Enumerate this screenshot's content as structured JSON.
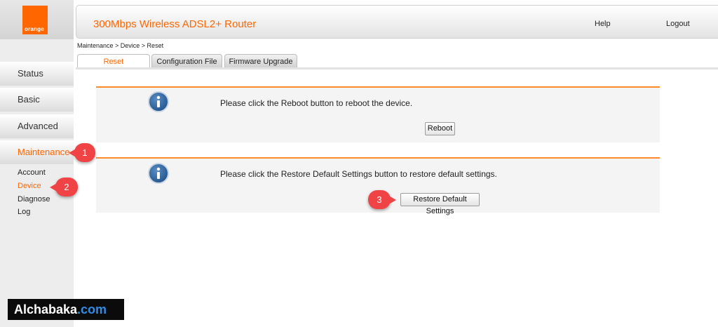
{
  "logo": {
    "text": "orange",
    "color": "#ff6600"
  },
  "header": {
    "title": "300Mbps Wireless ADSL2+ Router",
    "help": "Help",
    "logout": "Logout"
  },
  "breadcrumb": "Maintenance > Device > Reset",
  "tabs": [
    {
      "label": "Reset",
      "active": true
    },
    {
      "label": "Configuration File",
      "active": false
    },
    {
      "label": "Firmware Upgrade",
      "active": false
    }
  ],
  "sidebar": {
    "main": [
      {
        "label": "Status"
      },
      {
        "label": "Basic"
      },
      {
        "label": "Advanced"
      },
      {
        "label": "Maintenance",
        "active": true
      }
    ],
    "sub": [
      {
        "label": "Account"
      },
      {
        "label": "Device",
        "active": true
      },
      {
        "label": "Diagnose"
      },
      {
        "label": "Log"
      }
    ]
  },
  "panels": [
    {
      "icon": "info-icon",
      "text": "Please click the Reboot button to reboot the device.",
      "button": "Reboot"
    },
    {
      "icon": "info-icon",
      "text": "Please click the Restore Default Settings button to restore default settings.",
      "button": "Restore Default Settings"
    }
  ],
  "callouts": [
    "1",
    "2",
    "3"
  ],
  "watermark": {
    "main": "Alchabaka",
    "ext": ".com"
  },
  "colors": {
    "accent": "#ff6600",
    "callout": "#f04345",
    "panel_bg": "#f4f4f4",
    "link_blue": "#2f8de8"
  }
}
